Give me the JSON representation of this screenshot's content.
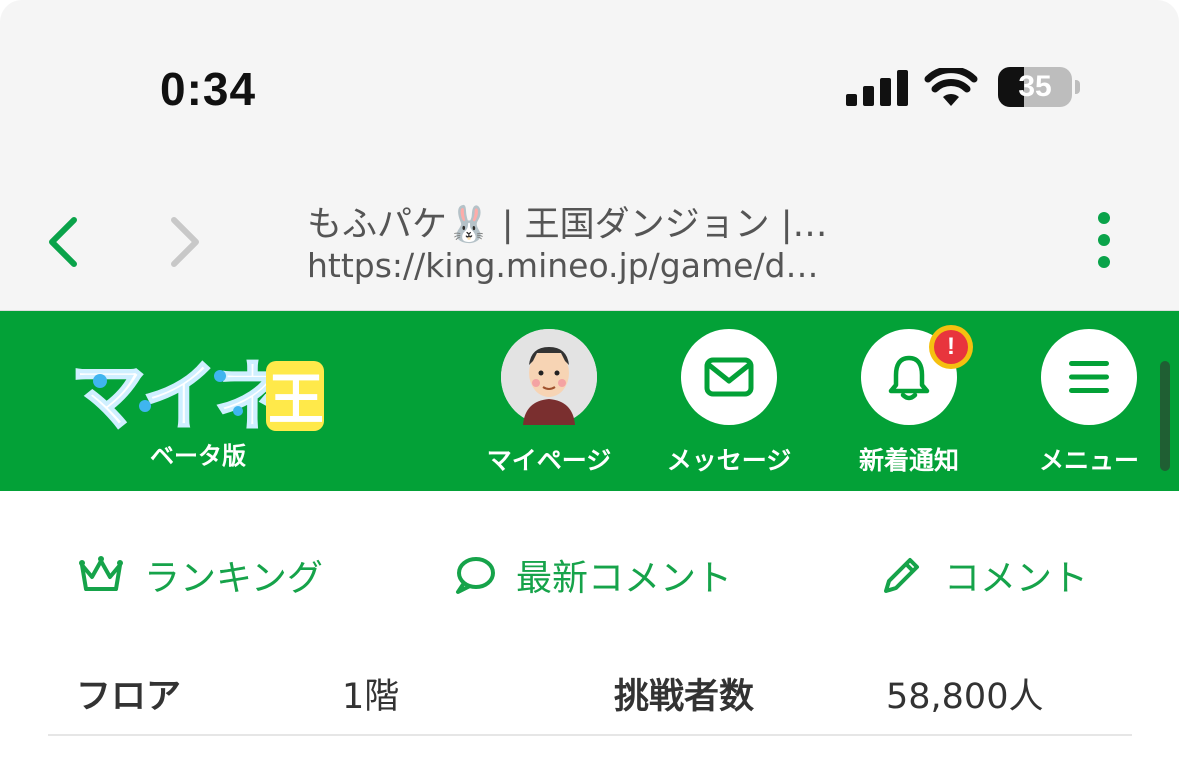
{
  "status_bar": {
    "time": "0:34",
    "battery": "35",
    "battery_level": 0.35
  },
  "browser": {
    "page_title": "もふパケ🐰 | 王国ダンジョン |…",
    "url": "https://king.mineo.jp/game/d…",
    "accent": "#0aa34a"
  },
  "header": {
    "brand_color": "#03a137",
    "logo_text": "マイネ王",
    "beta_label": "ベータ版",
    "buttons": [
      {
        "label": "マイページ",
        "icon": "avatar"
      },
      {
        "label": "メッセージ",
        "icon": "mail-icon"
      },
      {
        "label": "新着通知",
        "icon": "bell-icon",
        "badge": "!"
      },
      {
        "label": "メニュー",
        "icon": "hamburger-icon"
      }
    ]
  },
  "actions": [
    {
      "label": "ランキング",
      "icon": "crown-icon"
    },
    {
      "label": "最新コメント",
      "icon": "speech-bubble-icon"
    },
    {
      "label": "コメント",
      "icon": "pencil-icon"
    }
  ],
  "info": {
    "floor_label": "フロア",
    "floor_value": "1階",
    "challengers_label": "挑戦者数",
    "challengers_value": "58,800人"
  }
}
